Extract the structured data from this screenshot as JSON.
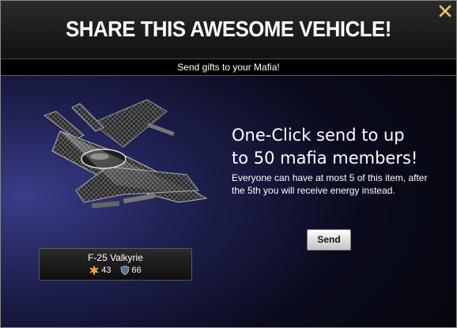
{
  "dialog": {
    "title": "SHARE THIS AWESOME VEHICLE!",
    "subtitle": "Send gifts to your Mafia!",
    "close_icon": "close-x-icon"
  },
  "item": {
    "name": "F-25 Valkyrie",
    "attack": "43",
    "defense": "66",
    "attack_icon": "attack-burst-icon",
    "defense_icon": "defense-shield-icon"
  },
  "offer": {
    "headline_line1": "One-Click send to up",
    "headline_line2": "to 50 mafia members!",
    "description": "Everyone can have at most 5 of this item, after the 5th you will receive energy instead.",
    "send_label": "Send"
  },
  "colors": {
    "accent": "#c8a04a",
    "background": "#0a0b1c"
  }
}
